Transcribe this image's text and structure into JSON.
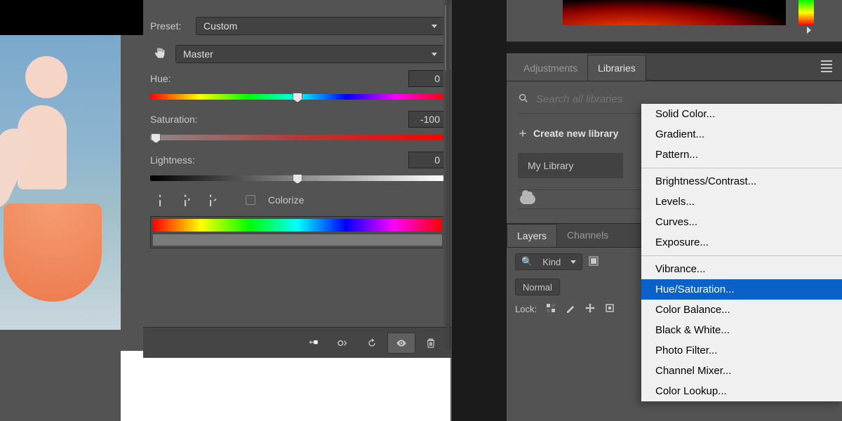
{
  "hs_panel": {
    "preset_label": "Preset:",
    "preset_value": "Custom",
    "channel_value": "Master",
    "hue": {
      "label": "Hue:",
      "value": "0",
      "thumb_pct": 50
    },
    "saturation": {
      "label": "Saturation:",
      "value": "-100",
      "thumb_pct": 2
    },
    "lightness": {
      "label": "Lightness:",
      "value": "0",
      "thumb_pct": 50
    },
    "colorize_label": "Colorize"
  },
  "right": {
    "tabs": {
      "adjustments": "Adjustments",
      "libraries": "Libraries"
    },
    "search_placeholder": "Search all libraries",
    "create_label": "Create new library",
    "my_library": "My Library",
    "layers_tabs": {
      "layers": "Layers",
      "channels": "Channels"
    },
    "kind_label": "Kind",
    "filter_icon": "🔍",
    "blend_mode": "Normal",
    "lock_label": "Lock:"
  },
  "ctx_menu": {
    "groups": [
      [
        "Solid Color...",
        "Gradient...",
        "Pattern..."
      ],
      [
        "Brightness/Contrast...",
        "Levels...",
        "Curves...",
        "Exposure..."
      ],
      [
        "Vibrance...",
        "Hue/Saturation...",
        "Color Balance...",
        "Black & White...",
        "Photo Filter...",
        "Channel Mixer...",
        "Color Lookup..."
      ]
    ],
    "selected": "Hue/Saturation..."
  }
}
